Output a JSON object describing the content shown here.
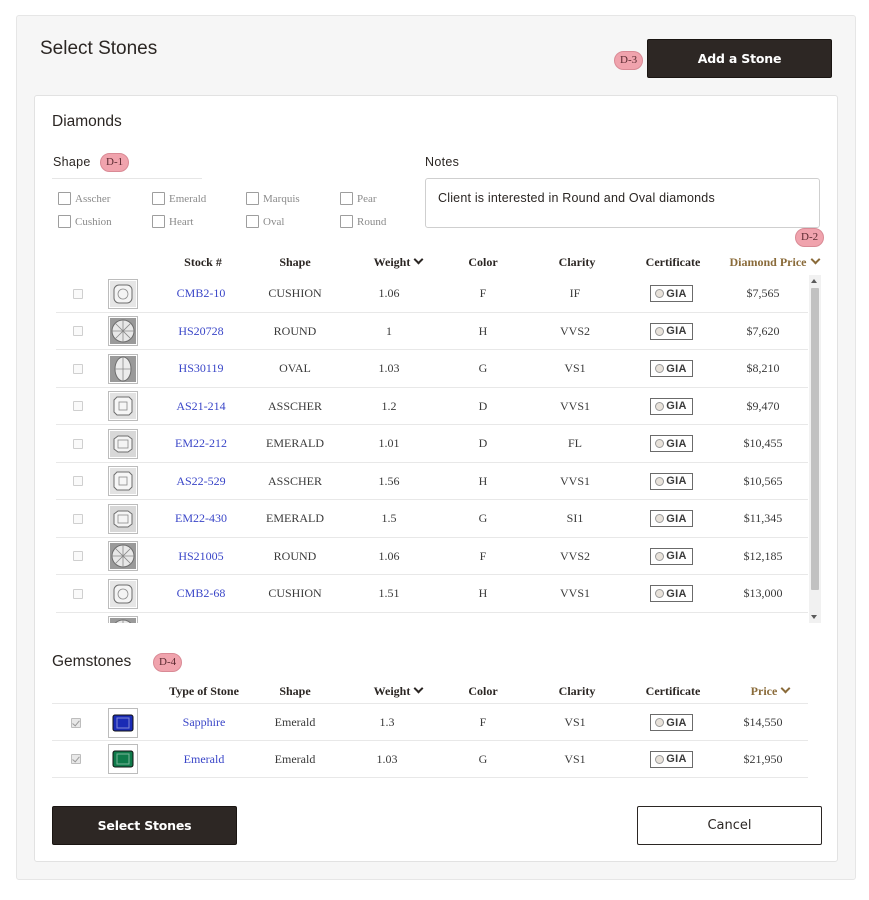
{
  "header": {
    "title": "Select Stones",
    "add_button": "Add a Stone"
  },
  "badges": {
    "shape": "D-1",
    "price": "D-2",
    "add": "D-3",
    "gemstones": "D-4"
  },
  "diamonds": {
    "title": "Diamonds",
    "shape_label": "Shape",
    "shapes": [
      "Asscher",
      "Emerald",
      "Marquis",
      "Pear",
      "Cushion",
      "Heart",
      "Oval",
      "Round"
    ],
    "notes_label": "Notes",
    "notes_value": "Client is interested in Round and Oval diamonds",
    "columns": {
      "stock": "Stock #",
      "shape": "Shape",
      "weight": "Weight",
      "color": "Color",
      "clarity": "Clarity",
      "certificate": "Certificate",
      "price": "Diamond Price"
    },
    "rows": [
      {
        "stock": "CMB2-10",
        "shape": "CUSHION",
        "weight": "1.06",
        "color": "F",
        "clarity": "IF",
        "cert": "GIA",
        "price": "$7,565",
        "thumb": "cushion"
      },
      {
        "stock": "HS20728",
        "shape": "ROUND",
        "weight": "1",
        "color": "H",
        "clarity": "VVS2",
        "cert": "GIA",
        "price": "$7,620",
        "thumb": "round"
      },
      {
        "stock": "HS30119",
        "shape": "OVAL",
        "weight": "1.03",
        "color": "G",
        "clarity": "VS1",
        "cert": "GIA",
        "price": "$8,210",
        "thumb": "oval"
      },
      {
        "stock": "AS21-214",
        "shape": "ASSCHER",
        "weight": "1.2",
        "color": "D",
        "clarity": "VVS1",
        "cert": "GIA",
        "price": "$9,470",
        "thumb": "asscher"
      },
      {
        "stock": "EM22-212",
        "shape": "EMERALD",
        "weight": "1.01",
        "color": "D",
        "clarity": "FL",
        "cert": "GIA",
        "price": "$10,455",
        "thumb": "emerald"
      },
      {
        "stock": "AS22-529",
        "shape": "ASSCHER",
        "weight": "1.56",
        "color": "H",
        "clarity": "VVS1",
        "cert": "GIA",
        "price": "$10,565",
        "thumb": "asscher"
      },
      {
        "stock": "EM22-430",
        "shape": "EMERALD",
        "weight": "1.5",
        "color": "G",
        "clarity": "SI1",
        "cert": "GIA",
        "price": "$11,345",
        "thumb": "emerald"
      },
      {
        "stock": "HS21005",
        "shape": "ROUND",
        "weight": "1.06",
        "color": "F",
        "clarity": "VVS2",
        "cert": "GIA",
        "price": "$12,185",
        "thumb": "round"
      },
      {
        "stock": "CMB2-68",
        "shape": "CUSHION",
        "weight": "1.51",
        "color": "H",
        "clarity": "VVS1",
        "cert": "GIA",
        "price": "$13,000",
        "thumb": "cushion"
      },
      {
        "stock": "",
        "shape": "",
        "weight": "",
        "color": "",
        "clarity": "",
        "cert": "",
        "price": "",
        "thumb": "round"
      }
    ]
  },
  "gemstones": {
    "title": "Gemstones",
    "columns": {
      "type": "Type of Stone",
      "shape": "Shape",
      "weight": "Weight",
      "color": "Color",
      "clarity": "Clarity",
      "certificate": "Certificate",
      "price": "Price"
    },
    "rows": [
      {
        "type": "Sapphire",
        "shape": "Emerald",
        "weight": "1.3",
        "color": "F",
        "clarity": "VS1",
        "cert": "GIA",
        "price": "$14,550",
        "checked": true,
        "gem_color": "#1a2bb5"
      },
      {
        "type": "Emerald",
        "shape": "Emerald",
        "weight": "1.03",
        "color": "G",
        "clarity": "VS1",
        "cert": "GIA",
        "price": "$21,950",
        "checked": true,
        "gem_color": "#0f7a4a"
      }
    ]
  },
  "footer": {
    "select_button": "Select Stones",
    "cancel_button": "Cancel"
  }
}
